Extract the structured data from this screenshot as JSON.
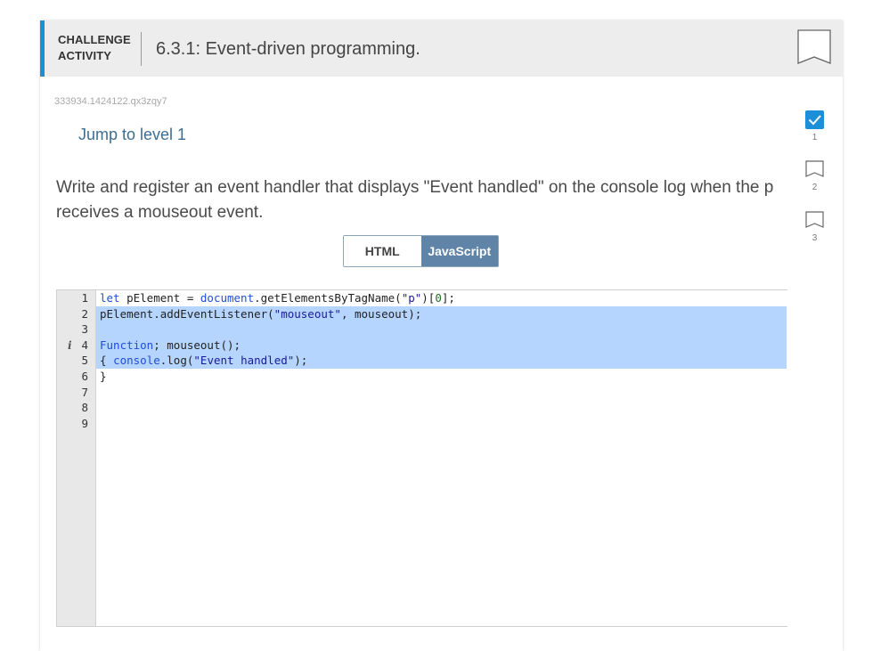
{
  "header": {
    "label_line1": "CHALLENGE",
    "label_line2": "ACTIVITY",
    "title": "6.3.1: Event-driven programming."
  },
  "challenge_id": "333934.1424122.qx3zqy7",
  "jump_link": "Jump to level 1",
  "prompt": "Write and register an event handler that displays \"Event handled\" on the console log when the p receives a mouseout event.",
  "tabs": [
    {
      "label": "HTML",
      "active": false
    },
    {
      "label": "JavaScript",
      "active": true
    }
  ],
  "levels": [
    {
      "number": "1",
      "completed": true
    },
    {
      "number": "2",
      "completed": false
    },
    {
      "number": "3",
      "completed": false
    }
  ],
  "editor": {
    "line_numbers": [
      "1",
      "2",
      "3",
      "4",
      "5",
      "6",
      "7",
      "8",
      "9"
    ],
    "info_marker_line": "4",
    "info_marker": "i",
    "code": [
      "let pElement = document.getElementsByTagName(\"p\")[0];",
      "pElement.addEventListener(\"mouseout\", mouseout);",
      "",
      "Function; mouseout();",
      "{ console.log(\"Event handled\");",
      "}",
      "",
      "",
      ""
    ]
  },
  "colors": {
    "accent": "#1d8ed8",
    "link": "#3c6e92",
    "tab_active": "#5f84a7",
    "selection": "#b5d5ff",
    "check": "#1d8ed8"
  },
  "icons": {
    "bookmark": "bookmark-icon",
    "check": "checkmark-icon"
  }
}
